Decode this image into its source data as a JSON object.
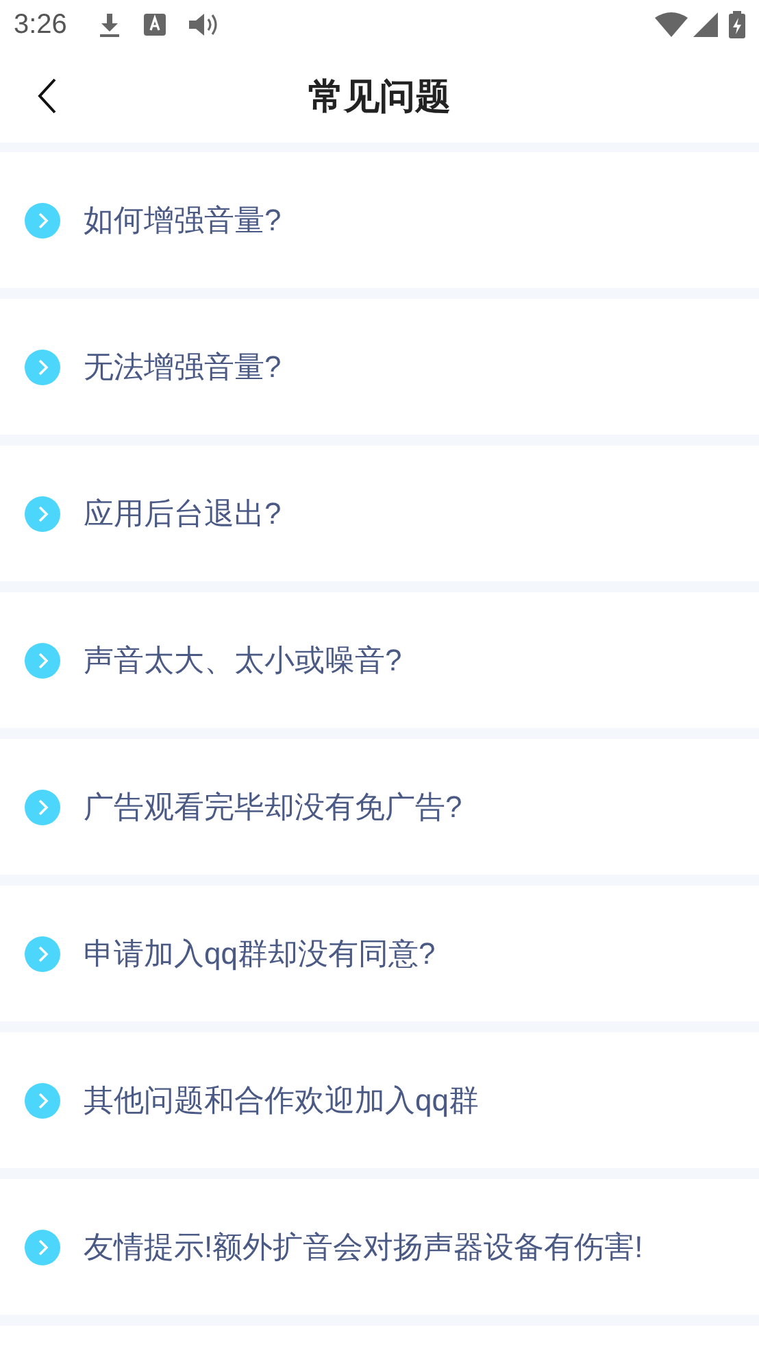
{
  "status_bar": {
    "time": "3:26"
  },
  "header": {
    "title": "常见问题"
  },
  "questions": [
    {
      "text": "如何增强音量?"
    },
    {
      "text": "无法增强音量?"
    },
    {
      "text": "应用后台退出?"
    },
    {
      "text": "声音太大、太小或噪音?"
    },
    {
      "text": "广告观看完毕却没有免广告?"
    },
    {
      "text": "申请加入qq群却没有同意?"
    },
    {
      "text": "其他问题和合作欢迎加入qq群"
    },
    {
      "text": "友情提示!额外扩音会对扬声器设备有伤害!"
    }
  ]
}
